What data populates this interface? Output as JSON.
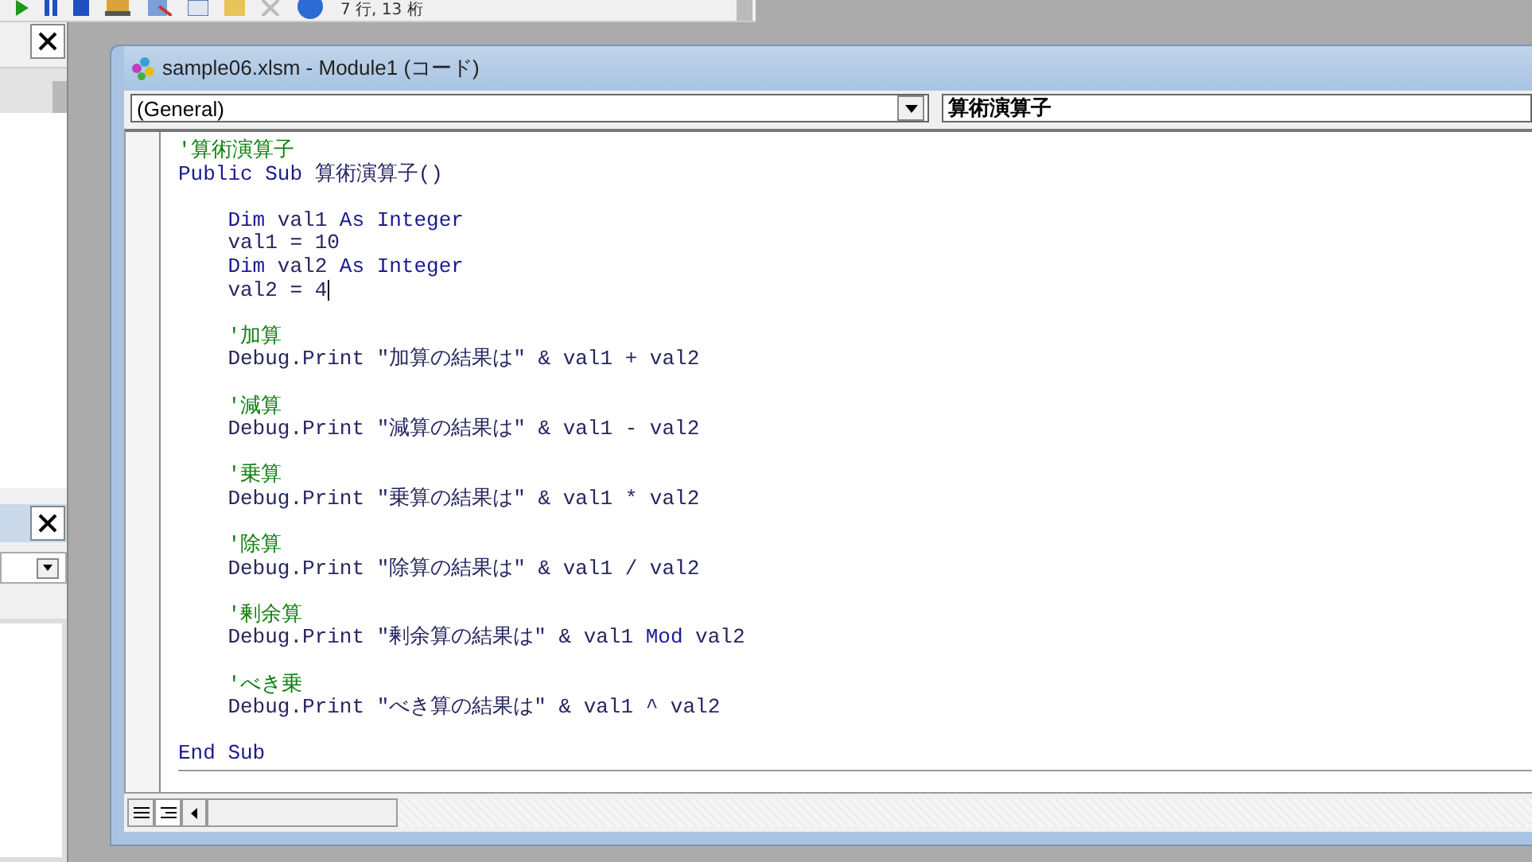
{
  "toolbar": {
    "position": "7 行, 13 桁"
  },
  "code_window": {
    "title": "sample06.xlsm - Module1 (コード)",
    "object_combo": "(General)",
    "procedure_combo": "算術演算子",
    "lines": [
      {
        "kind": "code",
        "segments": [
          {
            "kind": "comment",
            "text": "'算術演算子"
          }
        ]
      },
      {
        "kind": "code",
        "segments": [
          {
            "kind": "keyword",
            "text": "Public Sub"
          },
          {
            "kind": "text",
            "text": " 算術演算子()"
          }
        ]
      },
      {
        "kind": "blank"
      },
      {
        "kind": "code",
        "segments": [
          {
            "kind": "keyword",
            "text": "    Dim"
          },
          {
            "kind": "text",
            "text": " val1 "
          },
          {
            "kind": "keyword",
            "text": "As Integer"
          }
        ]
      },
      {
        "kind": "code",
        "segments": [
          {
            "kind": "text",
            "text": "    val1 = 10"
          }
        ]
      },
      {
        "kind": "code",
        "segments": [
          {
            "kind": "keyword",
            "text": "    Dim"
          },
          {
            "kind": "text",
            "text": " val2 "
          },
          {
            "kind": "keyword",
            "text": "As Integer"
          }
        ]
      },
      {
        "kind": "code",
        "caret": true,
        "segments": [
          {
            "kind": "text",
            "text": "    val2 = 4"
          }
        ]
      },
      {
        "kind": "blank"
      },
      {
        "kind": "code",
        "segments": [
          {
            "kind": "comment",
            "text": "    '加算"
          }
        ]
      },
      {
        "kind": "code",
        "segments": [
          {
            "kind": "text",
            "text": "    Debug.Print \"加算の結果は\" & val1 + val2"
          }
        ]
      },
      {
        "kind": "blank"
      },
      {
        "kind": "code",
        "segments": [
          {
            "kind": "comment",
            "text": "    '減算"
          }
        ]
      },
      {
        "kind": "code",
        "segments": [
          {
            "kind": "text",
            "text": "    Debug.Print \"減算の結果は\" & val1 - val2"
          }
        ]
      },
      {
        "kind": "blank"
      },
      {
        "kind": "code",
        "segments": [
          {
            "kind": "comment",
            "text": "    '乗算"
          }
        ]
      },
      {
        "kind": "code",
        "segments": [
          {
            "kind": "text",
            "text": "    Debug.Print \"乗算の結果は\" & val1 * val2"
          }
        ]
      },
      {
        "kind": "blank"
      },
      {
        "kind": "code",
        "segments": [
          {
            "kind": "comment",
            "text": "    '除算"
          }
        ]
      },
      {
        "kind": "code",
        "segments": [
          {
            "kind": "text",
            "text": "    Debug.Print \"除算の結果は\" & val1 / val2"
          }
        ]
      },
      {
        "kind": "blank"
      },
      {
        "kind": "code",
        "segments": [
          {
            "kind": "comment",
            "text": "    '剰余算"
          }
        ]
      },
      {
        "kind": "code",
        "segments": [
          {
            "kind": "text",
            "text": "    Debug.Print \"剰余算の結果は\" & val1 "
          },
          {
            "kind": "keyword",
            "text": "Mod"
          },
          {
            "kind": "text",
            "text": " val2"
          }
        ]
      },
      {
        "kind": "blank"
      },
      {
        "kind": "code",
        "segments": [
          {
            "kind": "comment",
            "text": "    'べき乗"
          }
        ]
      },
      {
        "kind": "code",
        "segments": [
          {
            "kind": "text",
            "text": "    Debug.Print \"べき算の結果は\" & val1 ^ val2"
          }
        ]
      },
      {
        "kind": "blank"
      },
      {
        "kind": "code",
        "end": true,
        "segments": [
          {
            "kind": "keyword",
            "text": "End Sub"
          }
        ]
      }
    ]
  }
}
